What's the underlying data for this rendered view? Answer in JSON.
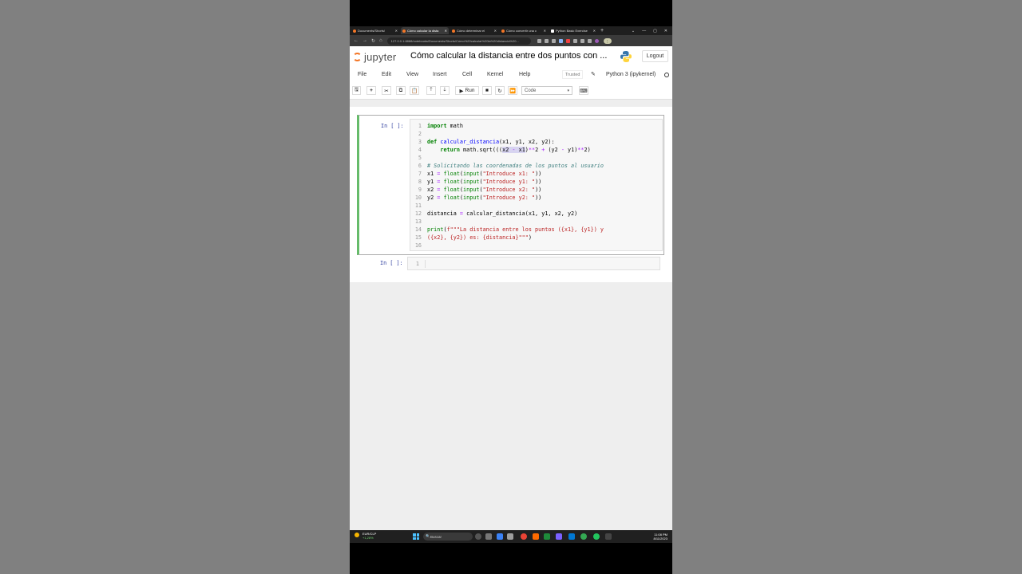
{
  "browser": {
    "tabs": [
      {
        "label": "Documents/Shorts/"
      },
      {
        "label": "Cómo calcular la dista"
      },
      {
        "label": "Cómo determinar el"
      },
      {
        "label": "Cómo convertir una c"
      },
      {
        "label": "Python Basic Exercise"
      }
    ],
    "active_tab_index": 1,
    "url": "127.0.0.1:8888/notebooks/Documents/Shorts/Cómo%20calcular%20la%20distancia%20..."
  },
  "jupyter": {
    "logo_text": "jupyter",
    "notebook_title": "Cómo calcular la distancia entre dos puntos con ...",
    "logout_label": "Logout",
    "menu": [
      "File",
      "Edit",
      "View",
      "Insert",
      "Cell",
      "Kernel",
      "Help"
    ],
    "trusted_label": "Trusted",
    "kernel_name": "Python 3 (ipykernel)",
    "toolbar": {
      "run_label": "Run",
      "cell_type": "Code"
    }
  },
  "cells": [
    {
      "prompt": "In [ ]:",
      "line_numbers": [
        "1",
        "2",
        "3",
        "4",
        "5",
        "6",
        "7",
        "8",
        "9",
        "10",
        "11",
        "12",
        "13",
        "14",
        "15",
        "16"
      ]
    },
    {
      "prompt": "In [ ]:",
      "line_numbers": [
        "1"
      ],
      "source": ""
    }
  ],
  "taskbar": {
    "weather_line1": "EUR/CLP",
    "weather_line2": "+1,28%",
    "search_placeholder": "Buscar",
    "time": "11:08 PM",
    "date": "8/11/2023"
  },
  "colors": {
    "jupyter_orange": "#f37626",
    "selected_cell_border": "#66bb6a",
    "prompt_blue": "#303f9f"
  }
}
